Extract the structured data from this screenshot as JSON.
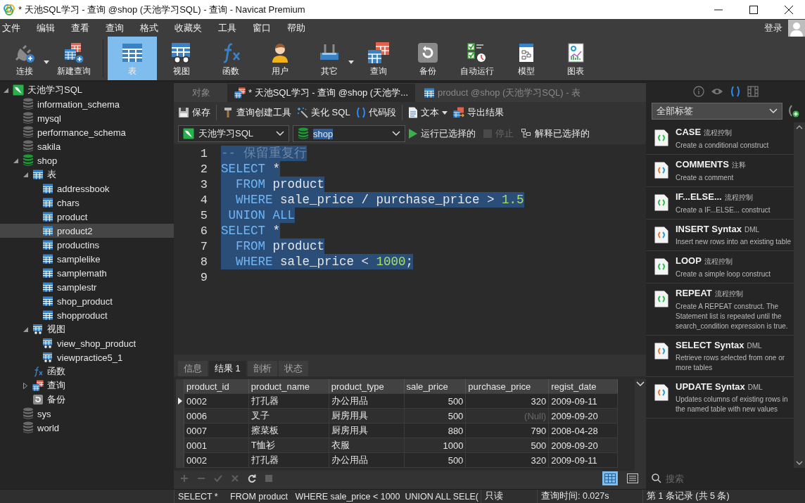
{
  "window": {
    "title": "* 天池SQL学习 - 查询 @shop (天池学习SQL) - 查询 - Navicat Premium"
  },
  "menu": {
    "items": [
      "文件",
      "编辑",
      "查看",
      "查询",
      "格式",
      "收藏夹",
      "工具",
      "窗口",
      "帮助"
    ],
    "login": "登录"
  },
  "toolbar": [
    {
      "label": "连接",
      "kind": "connect",
      "selected": false,
      "dropdown": true
    },
    {
      "label": "新建查询",
      "kind": "newquery",
      "selected": false,
      "dropdown": false
    },
    {
      "label": "表",
      "kind": "table",
      "selected": true,
      "dropdown": false
    },
    {
      "label": "视图",
      "kind": "view",
      "selected": false,
      "dropdown": false
    },
    {
      "label": "函数",
      "kind": "function",
      "selected": false,
      "dropdown": false
    },
    {
      "label": "用户",
      "kind": "user",
      "selected": false,
      "dropdown": false
    },
    {
      "label": "其它",
      "kind": "other",
      "selected": false,
      "dropdown": true
    },
    {
      "label": "查询",
      "kind": "query",
      "selected": false,
      "dropdown": false
    },
    {
      "label": "备份",
      "kind": "backup",
      "selected": false,
      "dropdown": false
    },
    {
      "label": "自动运行",
      "kind": "automation",
      "selected": false,
      "dropdown": false
    },
    {
      "label": "模型",
      "kind": "model",
      "selected": false,
      "dropdown": false
    },
    {
      "label": "图表",
      "kind": "chart",
      "selected": false,
      "dropdown": false
    }
  ],
  "sidebar": {
    "tree": [
      {
        "label": "天池学习SQL",
        "kind": "connection",
        "expanded": true,
        "selected": false,
        "children": [
          {
            "label": "information_schema",
            "kind": "database",
            "open": false,
            "selected": false
          },
          {
            "label": "mysql",
            "kind": "database",
            "open": false,
            "selected": false
          },
          {
            "label": "performance_schema",
            "kind": "database",
            "open": false,
            "selected": false
          },
          {
            "label": "sakila",
            "kind": "database",
            "open": false,
            "selected": false
          },
          {
            "label": "shop",
            "kind": "database",
            "open": true,
            "expanded": true,
            "selected": false,
            "children": [
              {
                "label": "表",
                "kind": "tables",
                "expanded": true,
                "selected": false,
                "children": [
                  {
                    "label": "addressbook",
                    "kind": "table",
                    "selected": false
                  },
                  {
                    "label": "chars",
                    "kind": "table",
                    "selected": false
                  },
                  {
                    "label": "product",
                    "kind": "table",
                    "selected": false
                  },
                  {
                    "label": "product2",
                    "kind": "table",
                    "selected": true
                  },
                  {
                    "label": "productins",
                    "kind": "table",
                    "selected": false
                  },
                  {
                    "label": "samplelike",
                    "kind": "table",
                    "selected": false
                  },
                  {
                    "label": "samplemath",
                    "kind": "table",
                    "selected": false
                  },
                  {
                    "label": "samplestr",
                    "kind": "table",
                    "selected": false
                  },
                  {
                    "label": "shop_product",
                    "kind": "table",
                    "selected": false
                  },
                  {
                    "label": "shopproduct",
                    "kind": "table",
                    "selected": false
                  }
                ]
              },
              {
                "label": "视图",
                "kind": "views",
                "expanded": true,
                "selected": false,
                "children": [
                  {
                    "label": "view_shop_product",
                    "kind": "view",
                    "selected": false
                  },
                  {
                    "label": "viewpractice5_1",
                    "kind": "view",
                    "selected": false
                  }
                ]
              },
              {
                "label": "函数",
                "kind": "functions",
                "selected": false
              },
              {
                "label": "查询",
                "kind": "queries",
                "expanded": false,
                "selected": false
              },
              {
                "label": "备份",
                "kind": "backups",
                "selected": false
              }
            ]
          },
          {
            "label": "sys",
            "kind": "database",
            "open": false,
            "selected": false
          },
          {
            "label": "world",
            "kind": "database",
            "open": false,
            "selected": false
          }
        ]
      }
    ]
  },
  "tabs": [
    {
      "label": "对象",
      "kind": "objects",
      "selected": false
    },
    {
      "label": "* 天池SQL学习 - 查询 @shop (天池学...",
      "kind": "query",
      "selected": true
    },
    {
      "label": "product @shop (天池学习SQL) - 表",
      "kind": "table",
      "selected": false
    }
  ],
  "editor_toolbar": [
    {
      "label": "保存",
      "kind": "save",
      "dropdown": false
    },
    {
      "label": "查询创建工具",
      "kind": "builder",
      "dropdown": false
    },
    {
      "label": "美化 SQL",
      "kind": "beautify",
      "dropdown": false
    },
    {
      "label": "代码段",
      "kind": "snippet",
      "dropdown": false
    },
    {
      "label": "文本",
      "kind": "text",
      "dropdown": true
    },
    {
      "label": "导出结果",
      "kind": "export",
      "dropdown": false
    }
  ],
  "selectors": {
    "connection": "天池学习SQL",
    "database": "shop",
    "run": "运行已选择的",
    "stop": {
      "label": "停止",
      "disabled": true
    },
    "explain": "解释已选择的"
  },
  "editor": {
    "lines": [
      {
        "number": "1",
        "selected": true,
        "tokens": [
          {
            "kind": "comment",
            "text": "-- 保留重复行"
          }
        ]
      },
      {
        "number": "2",
        "selected": true,
        "tokens": [
          {
            "kind": "keyword",
            "text": "SELECT"
          },
          {
            "kind": "plain",
            "text": " *"
          }
        ]
      },
      {
        "number": "3",
        "selected": true,
        "tokens": [
          {
            "kind": "keyword",
            "text": "  FROM"
          },
          {
            "kind": "plain",
            "text": " product"
          }
        ]
      },
      {
        "number": "4",
        "selected": true,
        "tokens": [
          {
            "kind": "keyword",
            "text": "  WHERE"
          },
          {
            "kind": "plain",
            "text": " sale_price / purchase_price > "
          },
          {
            "kind": "number",
            "text": "1.5"
          }
        ]
      },
      {
        "number": "5",
        "selected": true,
        "tokens": [
          {
            "kind": "keyword",
            "text": " UNION ALL"
          }
        ]
      },
      {
        "number": "6",
        "selected": true,
        "tokens": [
          {
            "kind": "keyword",
            "text": "SELECT"
          },
          {
            "kind": "plain",
            "text": " *"
          }
        ]
      },
      {
        "number": "7",
        "selected": true,
        "tokens": [
          {
            "kind": "keyword",
            "text": "  FROM"
          },
          {
            "kind": "plain",
            "text": " product"
          }
        ]
      },
      {
        "number": "8",
        "selected": true,
        "tokens": [
          {
            "kind": "keyword",
            "text": "  WHERE"
          },
          {
            "kind": "plain",
            "text": " sale_price < "
          },
          {
            "kind": "number",
            "text": "1000"
          },
          {
            "kind": "plain",
            "text": ";"
          }
        ]
      },
      {
        "number": "9"
      }
    ]
  },
  "result_tabs": [
    {
      "label": "信息",
      "selected": false
    },
    {
      "label": "结果 1",
      "selected": true
    },
    {
      "label": "剖析",
      "selected": false
    },
    {
      "label": "状态",
      "selected": false
    }
  ],
  "table": {
    "columns": [
      {
        "label": "product_id",
        "kind": "text"
      },
      {
        "label": "product_name",
        "kind": "text"
      },
      {
        "label": "product_type",
        "kind": "text"
      },
      {
        "label": "sale_price",
        "kind": "number"
      },
      {
        "label": "purchase_price",
        "kind": "number"
      },
      {
        "label": "regist_date",
        "kind": "text"
      }
    ],
    "rows": [
      {
        "current": true,
        "cells": [
          "0002",
          "打孔器",
          "办公用品",
          "500",
          "320",
          "2009-09-11"
        ]
      },
      {
        "current": false,
        "cells": [
          "0006",
          "叉子",
          "厨房用具",
          "500",
          {
            "text": "(Null)",
            "null": true
          },
          "2009-09-20"
        ]
      },
      {
        "current": false,
        "cells": [
          "0007",
          "擦菜板",
          "厨房用具",
          "880",
          "790",
          "2008-04-28"
        ]
      },
      {
        "current": false,
        "cells": [
          "0001",
          "T恤衫",
          "衣服",
          "1000",
          "500",
          "2009-09-20"
        ]
      },
      {
        "current": false,
        "cells": [
          "0002",
          "打孔器",
          "办公用品",
          "500",
          "320",
          "2009-09-11"
        ]
      }
    ]
  },
  "grid_tools": [
    {
      "kind": "add",
      "disabled": true
    },
    {
      "kind": "remove",
      "disabled": true
    },
    {
      "kind": "apply",
      "disabled": true
    },
    {
      "kind": "cancel",
      "disabled": true
    },
    {
      "kind": "refresh",
      "disabled": false
    },
    {
      "kind": "stop",
      "disabled": true
    }
  ],
  "view_modes": [
    {
      "kind": "grid",
      "selected": true
    },
    {
      "kind": "form",
      "selected": false
    }
  ],
  "right_panel": {
    "icons": [
      {
        "kind": "info",
        "selected": false
      },
      {
        "kind": "preview",
        "selected": false
      },
      {
        "kind": "snippets",
        "selected": true
      },
      {
        "kind": "template",
        "selected": false
      }
    ],
    "filter": "全部标签",
    "snippets": [
      {
        "title": "CASE",
        "tag": "流程控制",
        "desc": "Create a conditional construct",
        "kind": "control"
      },
      {
        "title": "COMMENTS",
        "tag": "注释",
        "desc": "Create a comment",
        "kind": "dml"
      },
      {
        "title": "IF...ELSE...",
        "tag": "流程控制",
        "desc": "Create a IF...ELSE... construct",
        "kind": "control"
      },
      {
        "title": "INSERT Syntax",
        "tag": "DML",
        "desc": "Insert new rows into an existing table",
        "kind": "dml"
      },
      {
        "title": "LOOP",
        "tag": "流程控制",
        "desc": "Create a simple loop construct",
        "kind": "control"
      },
      {
        "title": "REPEAT",
        "tag": "流程控制",
        "desc": "Create A REPEAT construct. The Statement list is repeated until the search_condition expression is true.",
        "kind": "control"
      },
      {
        "title": "SELECT Syntax",
        "tag": "DML",
        "desc": "Retrieve rows selected from one or more tables",
        "kind": "dml"
      },
      {
        "title": "UPDATE Syntax",
        "tag": "DML",
        "desc": "Updates columns of existing rows in the named table with new values",
        "kind": "dml"
      }
    ],
    "search": {
      "placeholder": "搜索"
    }
  },
  "status_bar": {
    "sql": "SELECT *     FROM product   WHERE sale_price < 1000  UNION ALL SELE(",
    "mode": "只读",
    "time": "查询时间: 0.027s",
    "records": "第 1 条记录 (共 5 条)"
  }
}
